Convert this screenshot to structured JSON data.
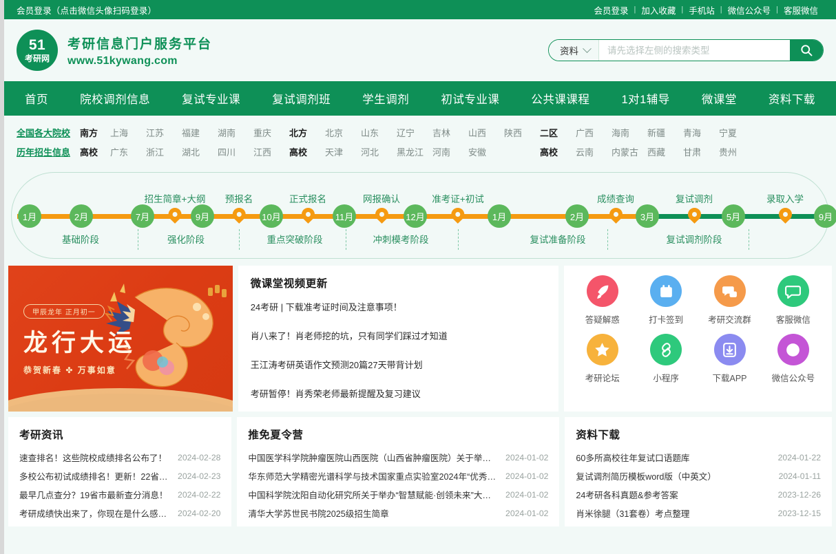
{
  "topbar": {
    "left_text": "会员登录（点击微信头像扫码登录）",
    "links": [
      "会员登录",
      "加入收藏",
      "手机站",
      "微信公众号",
      "客服微信"
    ],
    "separator": "|"
  },
  "brand": {
    "logo_number": "51",
    "logo_text": "考研网",
    "slogan": "考研信息门户服务平台",
    "url": "www.51kywang.com"
  },
  "search": {
    "category": "资料",
    "placeholder": "请先选择左侧的搜索类型",
    "value": ""
  },
  "mainnav": {
    "items": [
      "首页",
      "院校调剂信息",
      "复试专业课",
      "复试调剂班",
      "学生调剂",
      "初试专业课",
      "公共课课程",
      "1对1辅导",
      "微课堂",
      "资料下载"
    ]
  },
  "regions": {
    "row1": [
      "全国各大院校",
      "南方",
      "上海",
      "江苏",
      "福建",
      "湖南",
      "重庆",
      "北方",
      "北京",
      "山东",
      "辽宁",
      "吉林",
      "山西",
      "陕西",
      "二区",
      "广西",
      "海南",
      "新疆",
      "青海",
      "宁夏"
    ],
    "row2": [
      "历年招生信息",
      "高校",
      "广东",
      "浙江",
      "湖北",
      "四川",
      "江西",
      "高校",
      "天津",
      "河北",
      "黑龙江",
      "河南",
      "安徽",
      "",
      "高校",
      "云南",
      "内蒙古",
      "西藏",
      "甘肃",
      "贵州"
    ]
  },
  "timeline": {
    "months": [
      "1月",
      "2月",
      "7月",
      "9月",
      "10月",
      "11月",
      "12月",
      "1月",
      "2月",
      "3月",
      "5月",
      "9月"
    ],
    "pins": [
      "招生简章+大纲",
      "预报名",
      "正式报名",
      "网报确认",
      "准考证+初试",
      "成绩查询",
      "复试调剂",
      "录取入学"
    ],
    "phases": [
      "基础阶段",
      "强化阶段",
      "重点突破阶段",
      "冲刺模考阶段",
      "复试准备阶段",
      "复试调剂阶段"
    ],
    "orange_color": "#f59a11",
    "green_color": "#0e9057",
    "node_color": "#5cb85c"
  },
  "banner": {
    "tag": "甲辰龙年 正月初一",
    "headline": "龙行大运",
    "subline": "恭贺新春 ✤ 万事如意"
  },
  "micro_class": {
    "title": "微课堂视频更新",
    "items": [
      "24考研 | 下载准考证时间及注意事项！",
      "肖八来了！肖老师挖的坑，只有同学们踩过才知道",
      "王江涛考研英语作文预测20篇27天带背计划",
      "考研暂停！肖秀荣老师最新提醒及复习建议"
    ]
  },
  "quick_icons": [
    {
      "label": "答疑解惑",
      "icon": "rocket-icon",
      "color": "#f4556a"
    },
    {
      "label": "打卡签到",
      "icon": "calendar-icon",
      "color": "#5aaff0"
    },
    {
      "label": "考研交流群",
      "icon": "chat-group-icon",
      "color": "#f59a4a"
    },
    {
      "label": "客服微信",
      "icon": "wechat-service-icon",
      "color": "#2ec97c"
    },
    {
      "label": "考研论坛",
      "icon": "star-pen-icon",
      "color": "#f7b23c"
    },
    {
      "label": "小程序",
      "icon": "link-icon",
      "color": "#2ec97c"
    },
    {
      "label": "下载APP",
      "icon": "download-icon",
      "color": "#8b8bf0"
    },
    {
      "label": "微信公众号",
      "icon": "star-badge-icon",
      "color": "#c455d6"
    }
  ],
  "news_columns": [
    {
      "title": "考研资讯",
      "items": [
        {
          "text": "速查排名！这些院校成绩排名公布了！",
          "date": "2024-02-28"
        },
        {
          "text": "多校公布初试成绩排名！更新！22省…",
          "date": "2024-02-23"
        },
        {
          "text": "最早几点查分？19省市最新查分消息！",
          "date": "2024-02-22"
        },
        {
          "text": "考研成绩快出来了，你现在是什么感…",
          "date": "2024-02-20"
        }
      ]
    },
    {
      "title": "推免夏令营",
      "items": [
        {
          "text": "中国医学科学院肿瘤医院山西医院（山西省肿瘤医院）关于举办“…",
          "date": "2024-01-02"
        },
        {
          "text": "华东师范大学精密光谱科学与技术国家重点实验室2024年“优秀…",
          "date": "2024-01-02"
        },
        {
          "text": "中国科学院沈阳自动化研究所关于举办“智慧赋能·创领未来”大学…",
          "date": "2024-01-02"
        },
        {
          "text": "清华大学苏世民书院2025级招生简章",
          "date": "2024-01-02"
        }
      ]
    },
    {
      "title": "资料下载",
      "items": [
        {
          "text": "60多所高校往年复试口语题库",
          "date": "2024-01-22"
        },
        {
          "text": "复试调剂简历模板word版（中英文）",
          "date": "2024-01-11"
        },
        {
          "text": "24考研各科真题&参考答案",
          "date": "2023-12-26"
        },
        {
          "text": "肖米徐腿（31套卷）考点整理",
          "date": "2023-12-15"
        }
      ]
    }
  ]
}
